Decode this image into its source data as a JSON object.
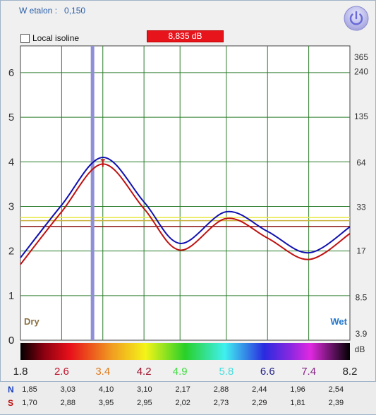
{
  "header": {
    "w_etalon_label": "W etalon :",
    "w_etalon_value": "0,150",
    "local_isoline_label": "Local isoline",
    "level_badge": "8,835 dB"
  },
  "icons": {
    "power": "power-icon"
  },
  "colors": {
    "grid": "#2e7d2e",
    "series_n": "#1010b0",
    "series_s": "#c01010",
    "cursor": "#8f8fd8",
    "badge": "#e8141c",
    "dry": "#8a7040",
    "wet": "#2277cc"
  },
  "chart_data": {
    "type": "line",
    "x": [
      "1.8",
      "2.6",
      "3.4",
      "4.2",
      "4.9",
      "5.8",
      "6.6",
      "7.4",
      "8.2"
    ],
    "series": [
      {
        "name": "N",
        "values": [
          1.85,
          3.03,
          4.1,
          3.1,
          2.17,
          2.88,
          2.44,
          1.96,
          2.54
        ]
      },
      {
        "name": "S",
        "values": [
          1.7,
          2.88,
          3.95,
          2.95,
          2.02,
          2.73,
          2.29,
          1.81,
          2.39
        ]
      }
    ],
    "ylim": [
      0,
      6.6
    ],
    "y_ticks": [
      "0",
      "1",
      "2",
      "3",
      "4",
      "5",
      "6"
    ],
    "right_axis_ticks": [
      "365",
      "240",
      "135",
      "64",
      "33",
      "17",
      "8.5",
      "3.9"
    ],
    "right_axis_unit": "dB",
    "x_tick_colors": [
      "#222222",
      "#c0102a",
      "#e07a1a",
      "#a0102a",
      "#44dd44",
      "#44dddd",
      "#222288",
      "#882288",
      "#222222"
    ],
    "dry_label": "Dry",
    "wet_label": "Wet",
    "cursor_x": 3.2,
    "peak_marker_x": 3.4,
    "reference_lines": [
      {
        "value": 2.75,
        "color": "#e8e850"
      },
      {
        "value": 2.68,
        "color": "#c8b040"
      },
      {
        "value": 2.55,
        "color": "#8b1010"
      }
    ],
    "grid": true
  },
  "table": {
    "row_n_label": "N",
    "row_s_label": "S",
    "row_n": [
      "1,85",
      "3,03",
      "4,10",
      "3,10",
      "2,17",
      "2,88",
      "2,44",
      "1,96",
      "2,54"
    ],
    "row_s": [
      "1,70",
      "2,88",
      "3,95",
      "2,95",
      "2,02",
      "2,73",
      "2,29",
      "1,81",
      "2,39"
    ]
  }
}
